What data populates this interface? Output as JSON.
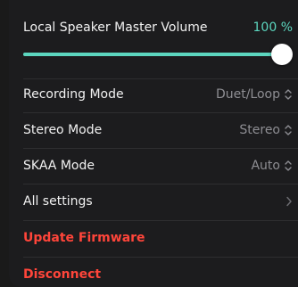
{
  "volume": {
    "title": "Local Speaker Master Volume",
    "value_text": "100 %",
    "level": 1.0
  },
  "settings": [
    {
      "label": "Recording Mode",
      "value": "Duet/Loop",
      "icon": "chevron-updown-icon"
    },
    {
      "label": "Stereo Mode",
      "value": "Stereo",
      "icon": "chevron-updown-icon"
    },
    {
      "label": "SKAA Mode",
      "value": "Auto",
      "icon": "chevron-updown-icon"
    },
    {
      "label": "All settings",
      "value": "",
      "icon": "chevron-right-icon"
    }
  ],
  "actions": {
    "update_firmware": "Update Firmware",
    "disconnect": "Disconnect"
  },
  "colors": {
    "accent": "#5cd6bf",
    "danger": "#ff453a",
    "panel": "#1c1c1e"
  }
}
